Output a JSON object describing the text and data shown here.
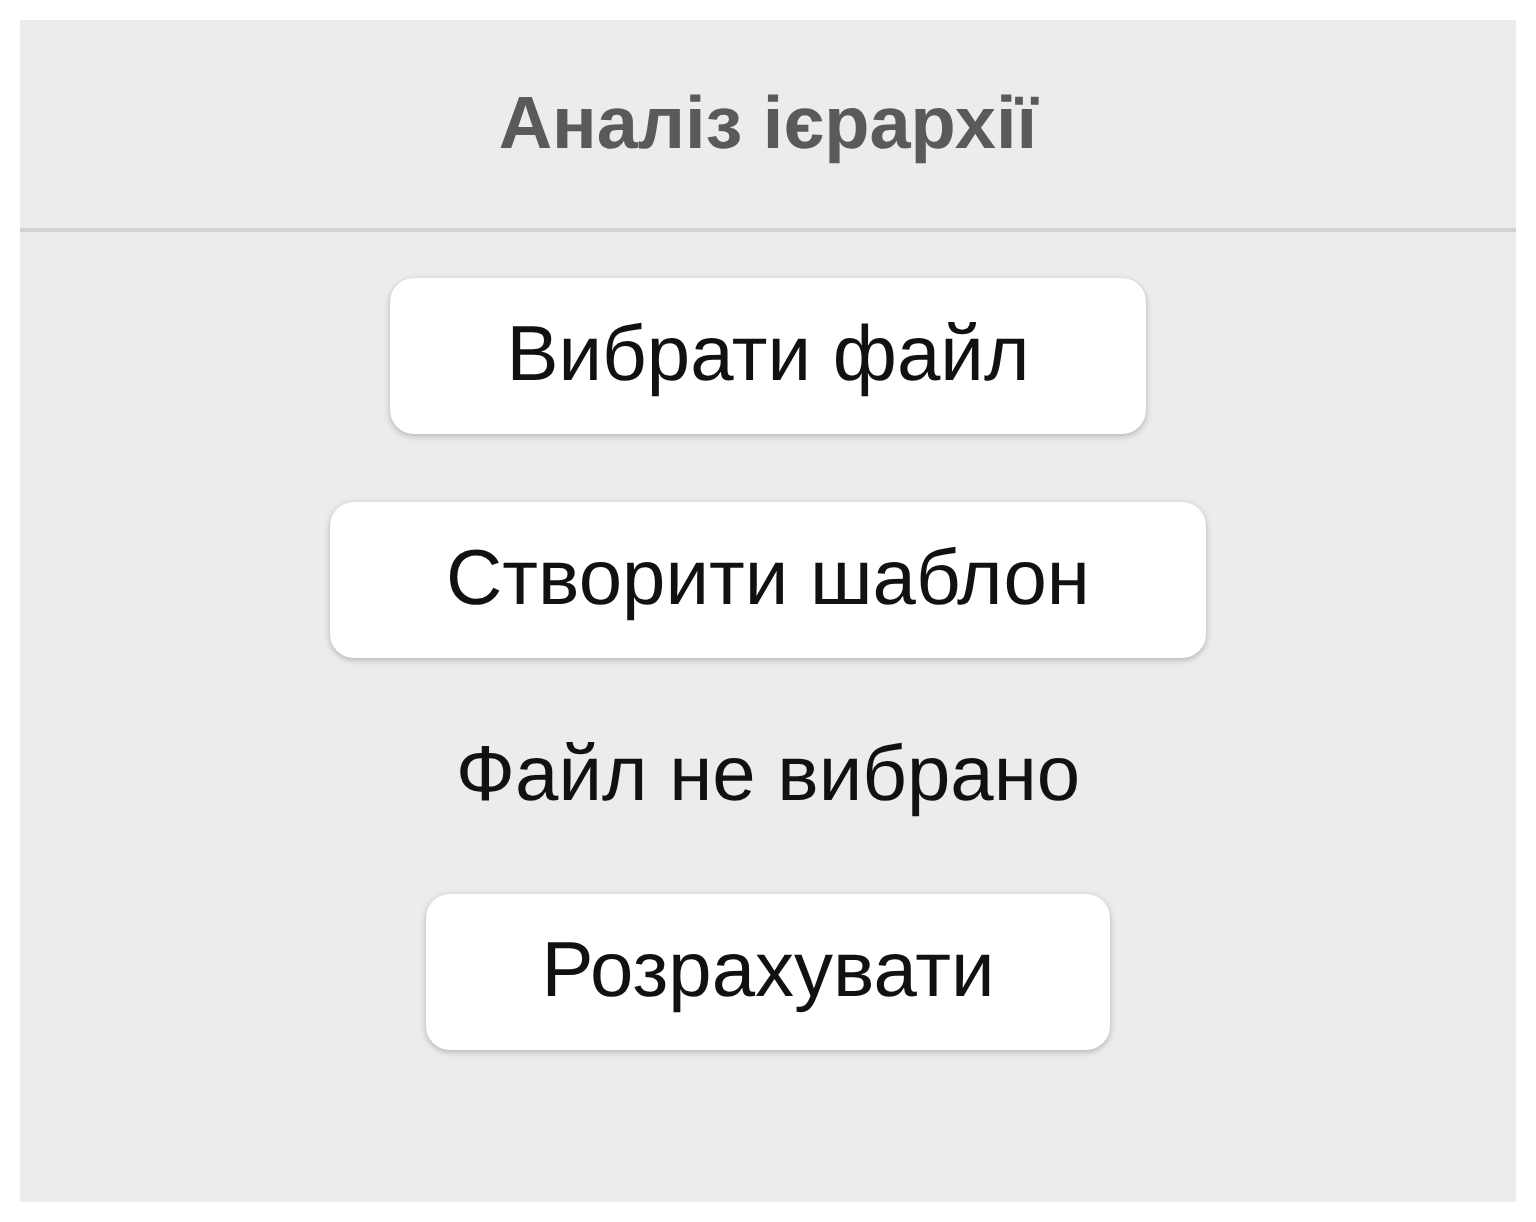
{
  "window": {
    "title": "Аналіз ієрархії"
  },
  "items": [
    {
      "kind": "button",
      "label": "Вибрати файл"
    },
    {
      "kind": "button",
      "label": "Створити шаблон"
    },
    {
      "kind": "text",
      "label": "Файл не вибрано"
    },
    {
      "kind": "button",
      "label": "Розрахувати"
    }
  ]
}
